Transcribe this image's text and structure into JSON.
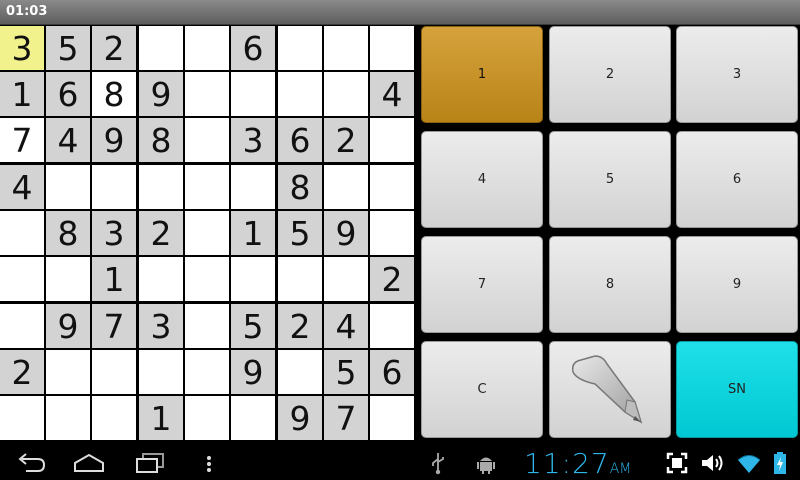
{
  "status_bar": {
    "time": "01:03"
  },
  "board": [
    [
      "3",
      "5",
      "2",
      "",
      "",
      "6",
      "",
      "",
      ""
    ],
    [
      "1",
      "6",
      "8",
      "9",
      "",
      "",
      "",
      "",
      "4"
    ],
    [
      "7",
      "4",
      "9",
      "8",
      "",
      "3",
      "6",
      "2",
      ""
    ],
    [
      "4",
      "",
      "",
      "",
      "",
      "",
      "8",
      "",
      ""
    ],
    [
      "",
      "8",
      "3",
      "2",
      "",
      "1",
      "5",
      "9",
      ""
    ],
    [
      "",
      "",
      "1",
      "",
      "",
      "",
      "",
      "",
      "2"
    ],
    [
      "",
      "9",
      "7",
      "3",
      "",
      "5",
      "2",
      "4",
      ""
    ],
    [
      "2",
      "",
      "",
      "",
      "",
      "9",
      "",
      "5",
      "6"
    ],
    [
      "",
      "",
      "",
      "1",
      "",
      "",
      "9",
      "7",
      ""
    ]
  ],
  "given_mask": [
    [
      0,
      1,
      1,
      0,
      0,
      1,
      0,
      0,
      0
    ],
    [
      1,
      1,
      0,
      1,
      0,
      0,
      0,
      0,
      1
    ],
    [
      0,
      1,
      1,
      1,
      0,
      1,
      1,
      1,
      0
    ],
    [
      1,
      0,
      0,
      0,
      0,
      0,
      1,
      0,
      0
    ],
    [
      0,
      1,
      1,
      1,
      0,
      1,
      1,
      1,
      0
    ],
    [
      0,
      0,
      1,
      0,
      0,
      0,
      0,
      0,
      1
    ],
    [
      0,
      1,
      1,
      1,
      0,
      1,
      1,
      1,
      0
    ],
    [
      1,
      0,
      0,
      0,
      0,
      1,
      0,
      1,
      1
    ],
    [
      0,
      0,
      0,
      1,
      0,
      0,
      1,
      1,
      0
    ]
  ],
  "selected_cell": {
    "row": 1,
    "col": 1
  },
  "keypad": {
    "k1": "1",
    "k2": "2",
    "k3": "3",
    "k4": "4",
    "k5": "5",
    "k6": "6",
    "k7": "7",
    "k8": "8",
    "k9": "9",
    "clear": "C",
    "pencil_icon": "pencil-icon",
    "sn": "SN",
    "active_color": "#c9951f",
    "sn_color": "#00cfd8"
  },
  "system_bar": {
    "clock": "11:27",
    "ampm": "AM",
    "icons": [
      "back-icon",
      "home-icon",
      "recent-apps-icon",
      "menu-icon",
      "usb-icon",
      "android-debug-icon",
      "screenshot-icon",
      "volume-icon",
      "wifi-icon",
      "battery-icon"
    ]
  }
}
